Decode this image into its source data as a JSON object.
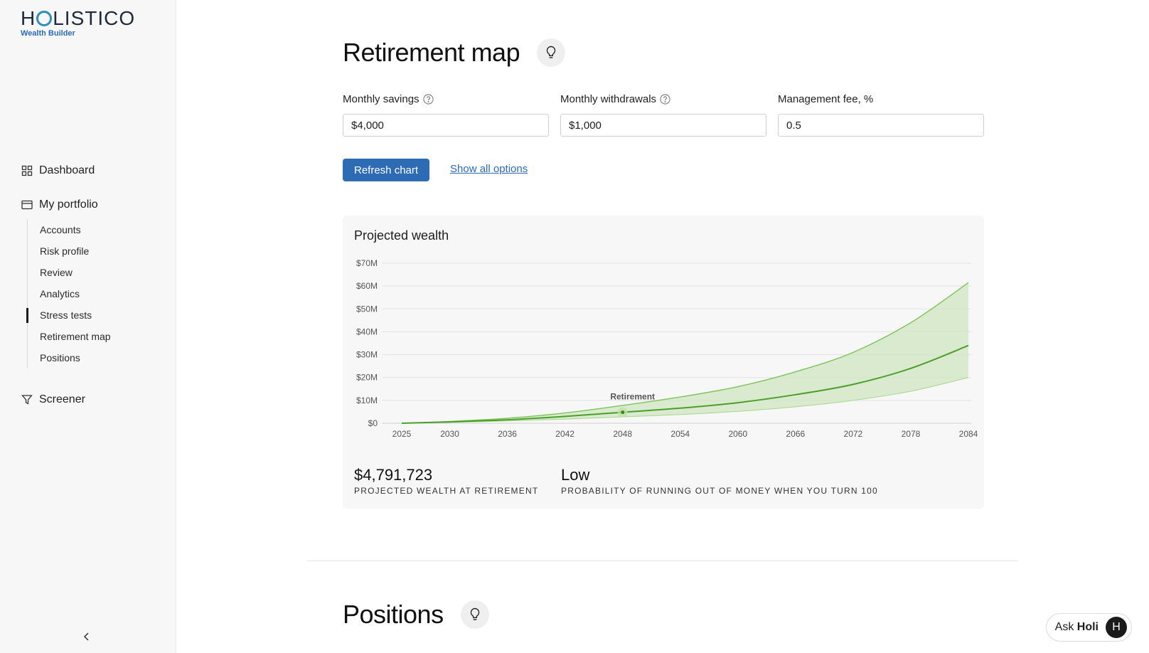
{
  "brand": {
    "name_prefix": "H",
    "name_suffix": "LISTICO",
    "subtitle": "Wealth Builder"
  },
  "sidebar": {
    "dashboard": "Dashboard",
    "portfolio": "My portfolio",
    "portfolio_items": [
      {
        "label": "Accounts"
      },
      {
        "label": "Risk profile"
      },
      {
        "label": "Review"
      },
      {
        "label": "Analytics"
      },
      {
        "label": "Stress tests",
        "active": true
      },
      {
        "label": "Retirement map"
      },
      {
        "label": "Positions"
      }
    ],
    "screener": "Screener"
  },
  "page": {
    "title": "Retirement map",
    "fields": {
      "monthly_savings": {
        "label": "Monthly savings",
        "value": "$4,000"
      },
      "monthly_withdrawals": {
        "label": "Monthly withdrawals",
        "value": "$1,000"
      },
      "management_fee": {
        "label": "Management fee, %",
        "value": "0.5"
      }
    },
    "refresh_button": "Refresh chart",
    "show_options_link": "Show all options",
    "stats": {
      "wealth_value": "$4,791,723",
      "wealth_label": "PROJECTED WEALTH AT RETIREMENT",
      "risk_value": "Low",
      "risk_label": "PROBABILITY OF RUNNING OUT OF MONEY WHEN YOU TURN 100"
    },
    "section2_title": "Positions"
  },
  "assistant": {
    "prefix": "Ask",
    "name": "Holi",
    "avatar_letter": "H"
  },
  "colors": {
    "accent": "#2d6bb5",
    "chart_line": "#4aa029",
    "chart_band": "#cfe6c0"
  },
  "chart_data": {
    "type": "area",
    "title": "Projected wealth",
    "y_ticks": [
      "$0",
      "$10M",
      "$20M",
      "$30M",
      "$40M",
      "$50M",
      "$60M",
      "$70M"
    ],
    "x_ticks": [
      "2025",
      "2030",
      "2036",
      "2042",
      "2048",
      "2054",
      "2060",
      "2066",
      "2072",
      "2078",
      "2084"
    ],
    "ylim": [
      0,
      70
    ],
    "y_unit": "$M",
    "x_range": [
      2025,
      2084
    ],
    "annotation": {
      "label": "Retirement",
      "x": 2048,
      "y": 4.8
    },
    "series": [
      {
        "role": "median",
        "x": [
          2025,
          2030,
          2036,
          2042,
          2048,
          2054,
          2060,
          2066,
          2072,
          2078,
          2084
        ],
        "values": [
          0,
          0.6,
          1.5,
          3.0,
          4.8,
          6.6,
          9.0,
          12.5,
          17.0,
          24.0,
          34.0
        ]
      },
      {
        "role": "upper",
        "x": [
          2025,
          2030,
          2036,
          2042,
          2048,
          2054,
          2060,
          2066,
          2072,
          2078,
          2084
        ],
        "values": [
          0,
          0.8,
          2.2,
          4.5,
          7.8,
          11.5,
          16.0,
          22.5,
          31.0,
          44.0,
          61.5
        ]
      },
      {
        "role": "lower",
        "x": [
          2025,
          2030,
          2036,
          2042,
          2048,
          2054,
          2060,
          2066,
          2072,
          2078,
          2084
        ],
        "values": [
          0,
          0.4,
          1.0,
          1.8,
          2.8,
          3.8,
          5.2,
          7.2,
          10.0,
          14.0,
          20.0
        ]
      }
    ],
    "grid": true
  }
}
